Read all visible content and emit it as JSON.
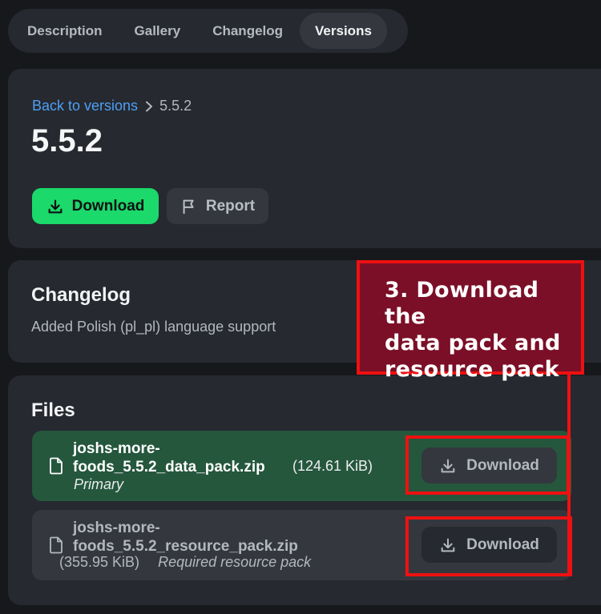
{
  "tabs": [
    {
      "label": "Description"
    },
    {
      "label": "Gallery"
    },
    {
      "label": "Changelog"
    },
    {
      "label": "Versions",
      "active": true
    }
  ],
  "version_card": {
    "breadcrumb_link": "Back to versions",
    "breadcrumb_current": "5.5.2",
    "title": "5.5.2",
    "download_label": "Download",
    "report_label": "Report"
  },
  "changelog": {
    "heading": "Changelog",
    "text": "Added Polish (pl_pl) language support"
  },
  "files": {
    "heading": "Files",
    "items": [
      {
        "name_line1": "joshs-more-",
        "name_line2": "foods_5.5.2_data_pack.zip",
        "size": "(124.61 KiB)",
        "tag": "Primary",
        "download_label": "Download"
      },
      {
        "name_line1": "joshs-more-",
        "name_line2": "foods_5.5.2_resource_pack.zip",
        "size": "(355.95 KiB)",
        "tag": "Required resource pack",
        "download_label": "Download"
      }
    ]
  },
  "annotation": {
    "line1": "3. Download the",
    "line2": "data pack and",
    "line3": "resource pack"
  },
  "colors": {
    "accent_green": "#1bd96a",
    "link_blue": "#4e9ff5",
    "primary_file_bg": "#25573d",
    "annotation_red": "#ee1111",
    "annotation_fill": "#7b0f27"
  }
}
